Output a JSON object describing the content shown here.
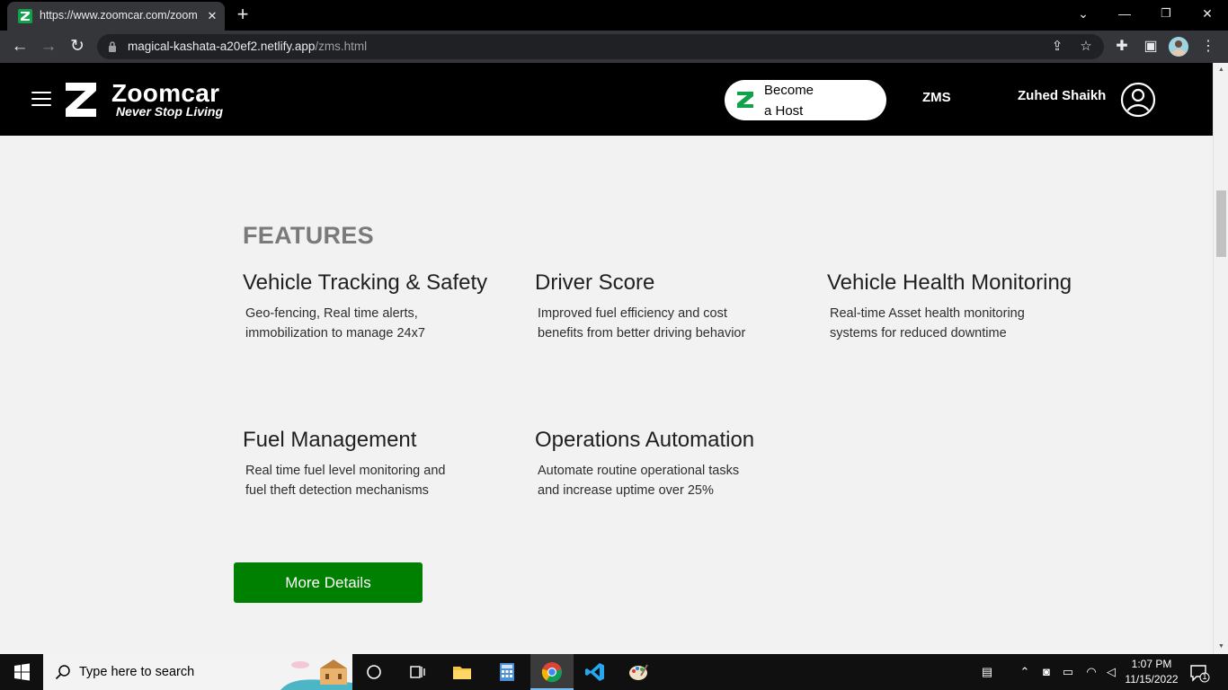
{
  "browser": {
    "tab_title": "https://www.zoomcar.com/zoom",
    "url_host": "magical-kashata-a20ef2.netlify.app",
    "url_path": "/zms.html"
  },
  "header": {
    "brand_name": "Zoomcar",
    "brand_tagline": "Never Stop Living",
    "host_line1": "Become",
    "host_line2": "a Host",
    "zms_label": "ZMS",
    "user_name": "Zuhed Shaikh"
  },
  "features": {
    "heading": "FEATURES",
    "items": [
      {
        "title": "Vehicle Tracking & Safety",
        "desc_line1": "Geo-fencing, Real time alerts,",
        "desc_line2": "immobilization to manage 24x7"
      },
      {
        "title": "Driver Score",
        "desc_line1": "Improved fuel efficiency and cost",
        "desc_line2": "benefits from better driving behavior"
      },
      {
        "title": "Vehicle Health Monitoring",
        "desc_line1": "Real-time Asset health monitoring",
        "desc_line2": "systems for reduced downtime"
      },
      {
        "title": "Fuel Management",
        "desc_line1": "Real time fuel level monitoring and",
        "desc_line2": "fuel theft detection mechanisms"
      },
      {
        "title": "Operations Automation",
        "desc_line1": "Automate routine operational tasks",
        "desc_line2": "and increase uptime over 25%"
      }
    ],
    "more_button": "More Details"
  },
  "taskbar": {
    "search_placeholder": "Type here to search",
    "time": "1:07 PM",
    "date": "11/15/2022",
    "notification_count": "1"
  },
  "colors": {
    "accent_green": "#008000",
    "brand_green": "#10a14b",
    "header_bg": "#000000",
    "page_bg": "#f2f2f2"
  }
}
